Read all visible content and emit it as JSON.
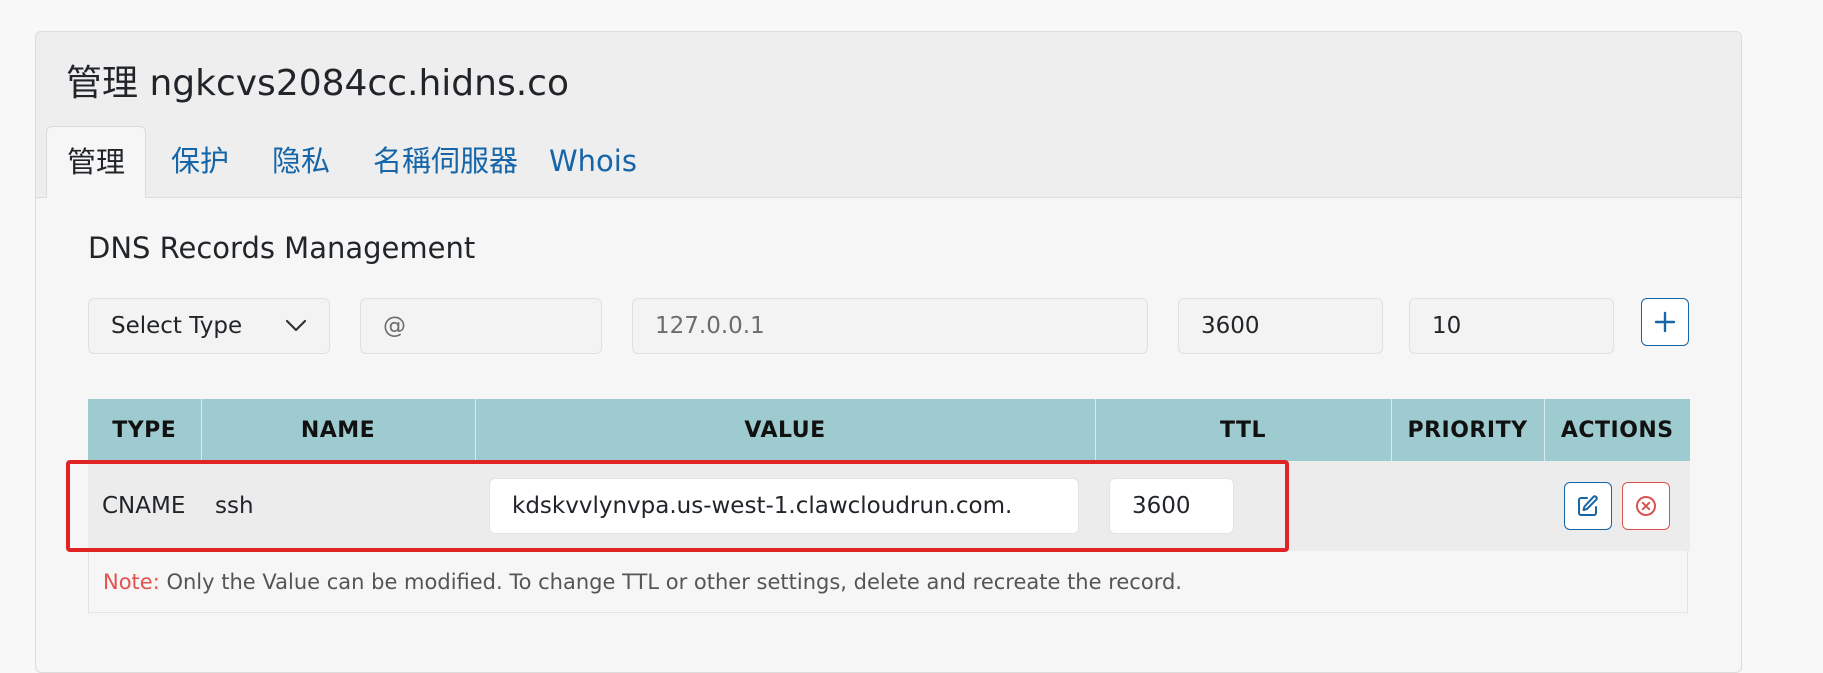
{
  "panel": {
    "title": "管理 ngkcvs2084cc.hidns.co"
  },
  "tabs": [
    {
      "label": "管理",
      "active": true
    },
    {
      "label": "保护",
      "active": false
    },
    {
      "label": "隐私",
      "active": false
    },
    {
      "label": "名稱伺服器",
      "active": false
    },
    {
      "label": "Whois",
      "active": false
    }
  ],
  "dns": {
    "section_title": "DNS Records Management",
    "form": {
      "type_select": "Select Type",
      "name_placeholder": "@",
      "value_placeholder": "127.0.0.1",
      "ttl_value": "3600",
      "priority_value": "10",
      "add_icon": "plus-icon"
    },
    "table": {
      "headers": [
        "TYPE",
        "NAME",
        "VALUE",
        "TTL",
        "PRIORITY",
        "ACTIONS"
      ],
      "rows": [
        {
          "type": "CNAME",
          "name": "ssh",
          "value": "kdskvvlynvpa.us-west-1.clawcloudrun.com.",
          "ttl": "3600",
          "priority": "",
          "edit_icon": "edit-icon",
          "delete_icon": "delete-circle-x-icon"
        }
      ]
    },
    "note": {
      "label": "Note:",
      "text": " Only the Value can be modified. To change TTL or other settings, delete and recreate the record."
    }
  },
  "colors": {
    "link_blue": "#1565a8",
    "table_header": "#9dcbcf",
    "danger_red": "#d9534f",
    "highlight_red": "#e02424"
  }
}
